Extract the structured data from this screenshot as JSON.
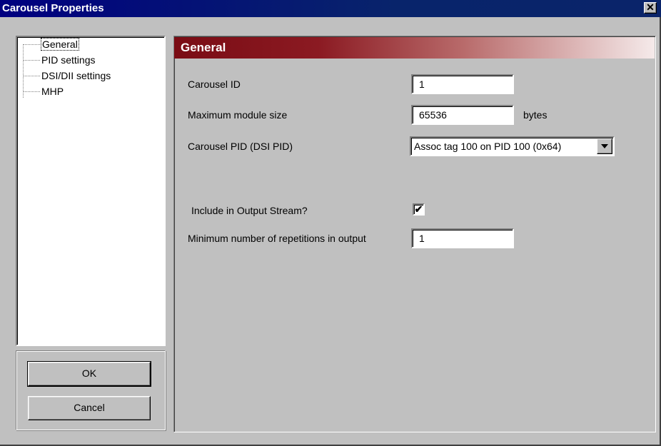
{
  "window": {
    "title": "Carousel Properties",
    "close_symbol": "✕"
  },
  "tree": {
    "items": [
      {
        "label": "General",
        "selected": true
      },
      {
        "label": "PID settings",
        "selected": false
      },
      {
        "label": "DSI/DII settings",
        "selected": false
      },
      {
        "label": "MHP",
        "selected": false
      }
    ]
  },
  "buttons": {
    "ok": "OK",
    "cancel": "Cancel"
  },
  "panel": {
    "header": "General",
    "carousel_id": {
      "label": "Carousel ID",
      "value": "1"
    },
    "max_module_size": {
      "label": "Maximum module size",
      "value": "65536",
      "unit": "bytes"
    },
    "carousel_pid": {
      "label": "Carousel PID (DSI PID)",
      "selected": "Assoc tag 100 on PID 100 (0x64)"
    },
    "include_output": {
      "label": "Include in Output Stream?",
      "checked": true,
      "check_symbol": "✔"
    },
    "min_repetitions": {
      "label": "Minimum number of repetitions in output",
      "value": "1"
    }
  },
  "colors": {
    "title_bar": "#0a246a",
    "header_start": "#7a0c14",
    "face": "#c0c0c0"
  }
}
